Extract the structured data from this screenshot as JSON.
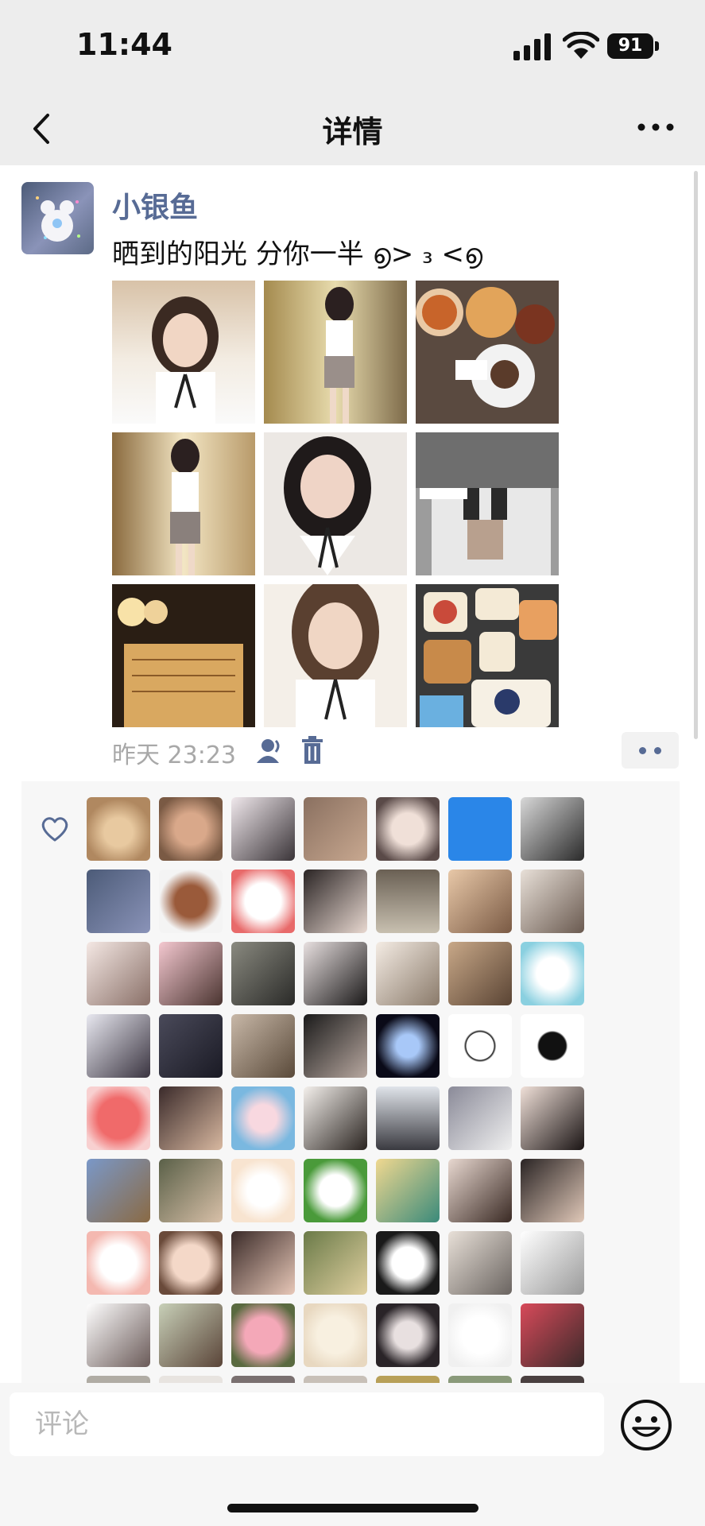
{
  "status_bar": {
    "time": "11:44",
    "battery": "91"
  },
  "nav": {
    "title": "详情",
    "back_icon": "chevron-left-icon",
    "more_icon": "more-horizontal-icon"
  },
  "post": {
    "nickname": "小银鱼",
    "text": "晒到的阳光 分你一半 ൭> ₃ <൭",
    "photos": [
      {
        "name": "photo-selfie-1"
      },
      {
        "name": "photo-outfit-1"
      },
      {
        "name": "photo-food-pizza"
      },
      {
        "name": "photo-outfit-2"
      },
      {
        "name": "photo-selfie-2"
      },
      {
        "name": "photo-legs"
      },
      {
        "name": "photo-candle-book"
      },
      {
        "name": "photo-selfie-3"
      },
      {
        "name": "photo-desserts"
      }
    ],
    "time": "昨天 23:23",
    "visibility_icon": "friends-icon",
    "delete_icon": "trash-icon",
    "action_icon": "more-dots-icon"
  },
  "likes": {
    "icon": "heart-outline-icon",
    "rows_visible": 8,
    "columns": 7
  },
  "comment_bar": {
    "placeholder": "评论",
    "emoji_icon": "emoji-icon"
  },
  "colors": {
    "nickname": "#576b95",
    "background": "#ededed",
    "likes_panel": "#f7f7f7"
  }
}
